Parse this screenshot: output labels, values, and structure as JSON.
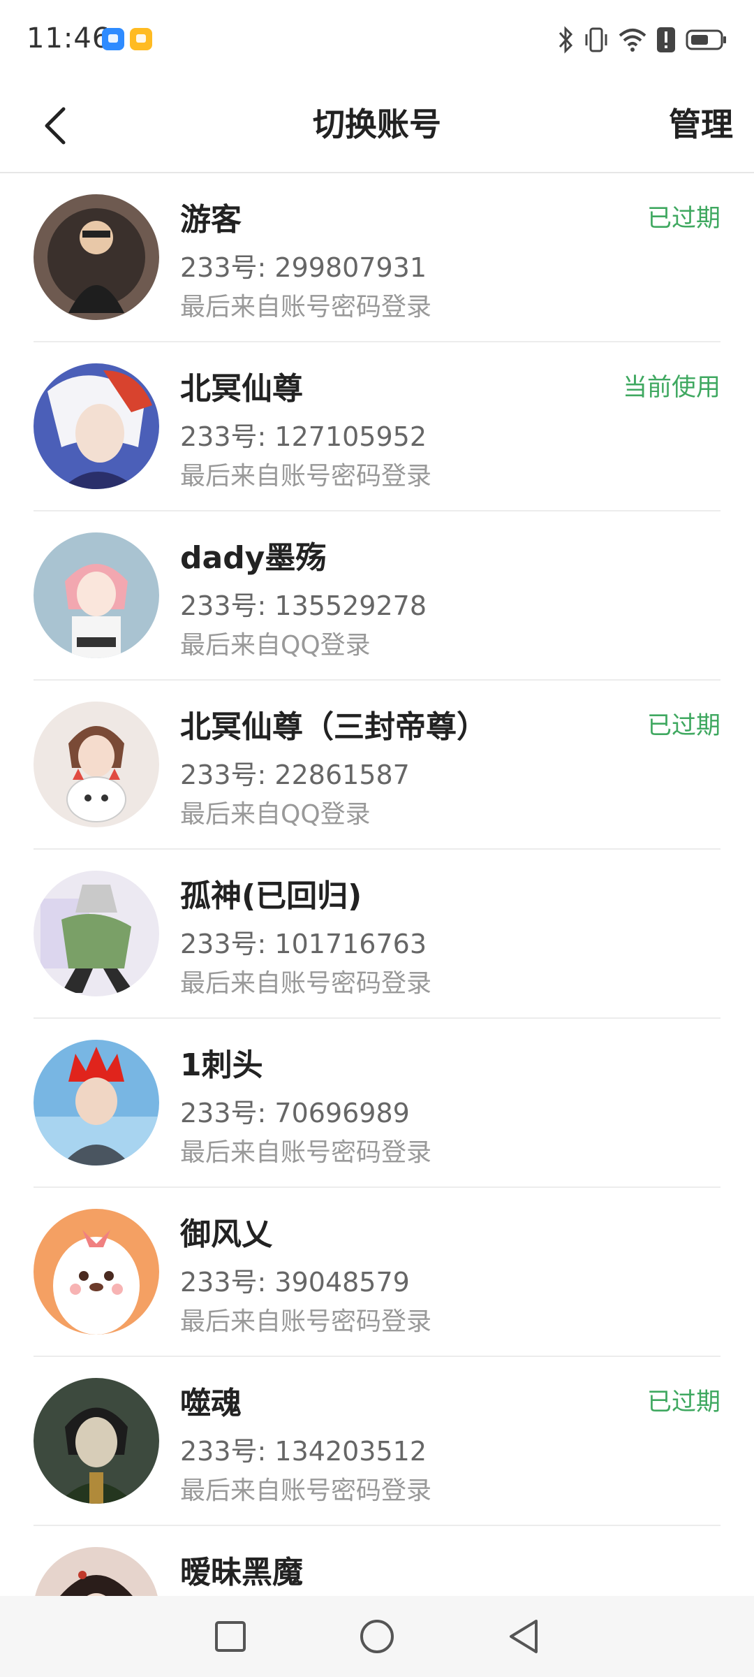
{
  "status_bar": {
    "time": "11:46",
    "icons": [
      "app-notification-icon-blue",
      "app-notification-icon-yellow",
      "bluetooth-icon",
      "vibrate-icon",
      "wifi-icon",
      "alert-icon",
      "battery-icon"
    ]
  },
  "header": {
    "title": "切换账号",
    "manage_label": "管理",
    "back_icon": "chevron-left-icon"
  },
  "colors": {
    "status_green": "#3fa860",
    "text_primary": "#222222",
    "text_secondary": "#666666",
    "text_tertiary": "#999999"
  },
  "accounts": [
    {
      "name": "游客",
      "id": "233号: 299807931",
      "source": "最后来自账号密码登录",
      "status": "已过期"
    },
    {
      "name": "北冥仙尊",
      "id": "233号: 127105952",
      "source": "最后来自账号密码登录",
      "status": "当前使用"
    },
    {
      "name": "dady墨殇",
      "id": "233号: 135529278",
      "source": "最后来自QQ登录",
      "status": ""
    },
    {
      "name": "北冥仙尊（三封帝尊）",
      "id": "233号: 22861587",
      "source": "最后来自QQ登录",
      "status": "已过期"
    },
    {
      "name": "孤神(已回归)",
      "id": "233号: 101716763",
      "source": "最后来自账号密码登录",
      "status": ""
    },
    {
      "name": "1刺头",
      "id": "233号: 70696989",
      "source": "最后来自账号密码登录",
      "status": ""
    },
    {
      "name": "御风乂",
      "id": "233号: 39048579",
      "source": "最后来自账号密码登录",
      "status": ""
    },
    {
      "name": "噬魂",
      "id": "233号: 134203512",
      "source": "最后来自账号密码登录",
      "status": "已过期"
    },
    {
      "name": "暧昧黑魔",
      "id": "",
      "source": "",
      "status": ""
    }
  ],
  "nav": {
    "icons": [
      "recent-apps-icon",
      "home-icon",
      "back-icon"
    ]
  }
}
